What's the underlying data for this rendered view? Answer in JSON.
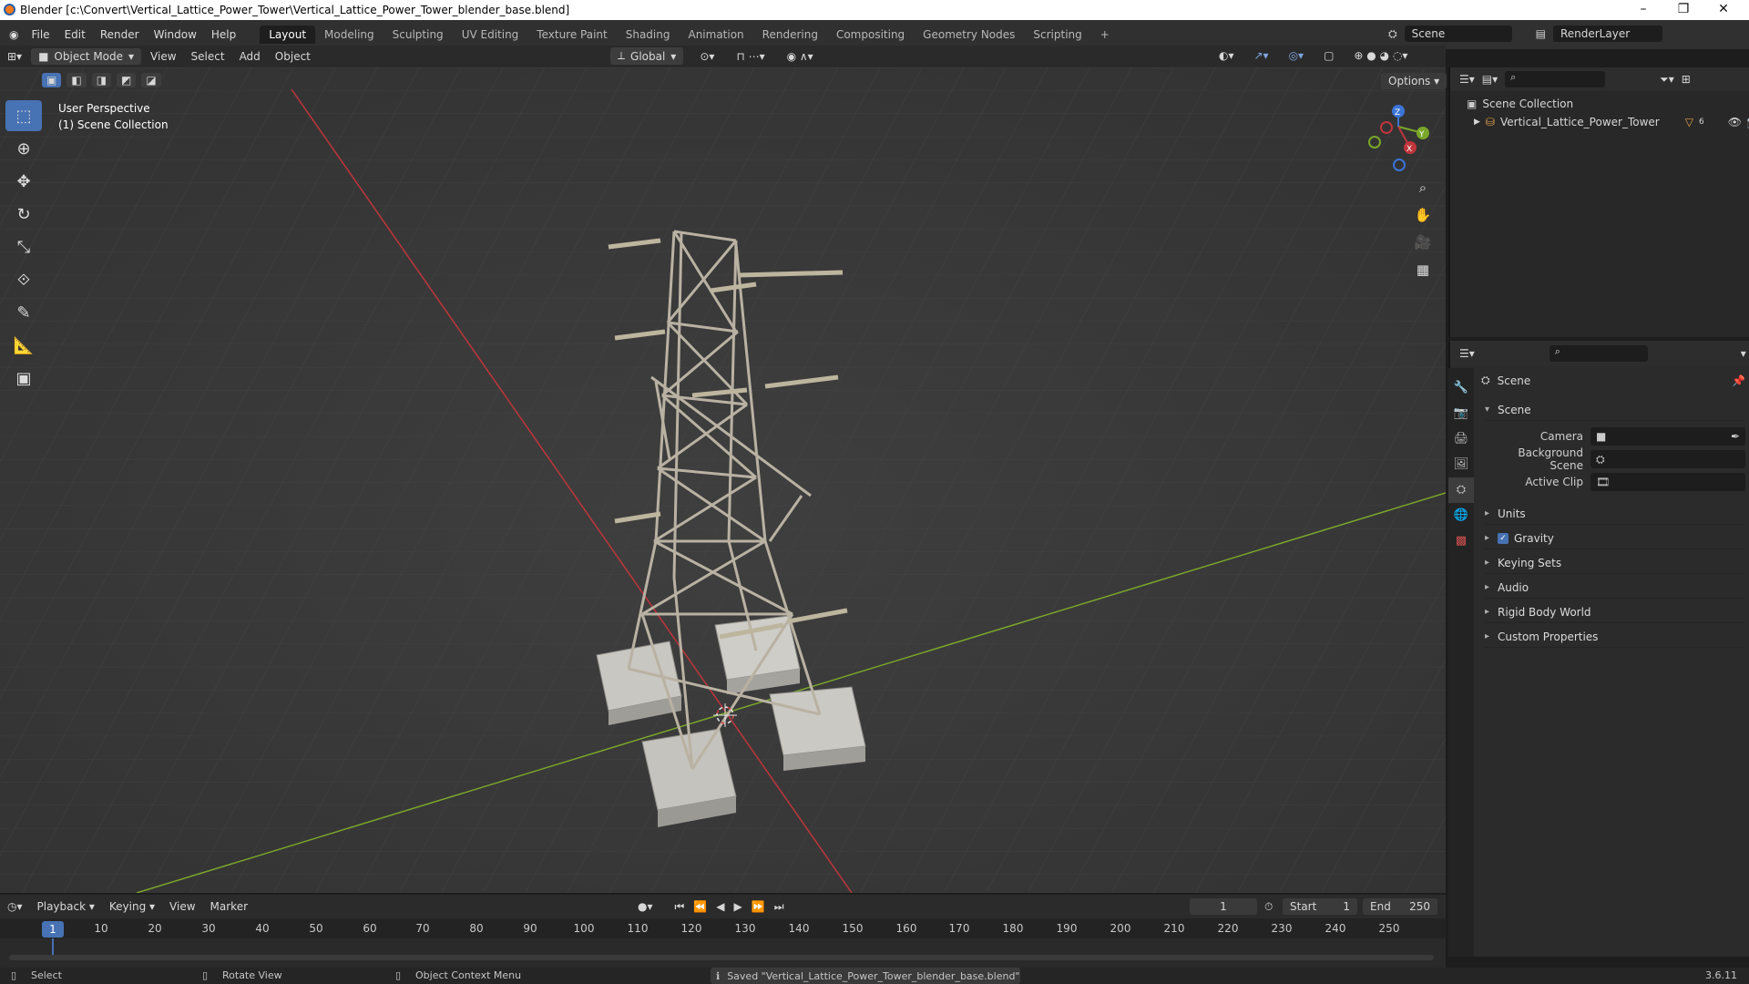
{
  "window": {
    "title": "Blender [c:\\Convert\\Vertical_Lattice_Power_Tower\\Vertical_Lattice_Power_Tower_blender_base.blend]",
    "minimize": "–",
    "maximize": "❐",
    "close": "✕"
  },
  "menus": [
    "File",
    "Edit",
    "Render",
    "Window",
    "Help"
  ],
  "workspaces": [
    "Layout",
    "Modeling",
    "Sculpting",
    "UV Editing",
    "Texture Paint",
    "Shading",
    "Animation",
    "Rendering",
    "Compositing",
    "Geometry Nodes",
    "Scripting"
  ],
  "workspace_add": "+",
  "scene_selector": "Scene",
  "view_layer_selector": "RenderLayer",
  "viewport_header": {
    "mode": "Object Mode",
    "menus": [
      "View",
      "Select",
      "Add",
      "Object"
    ],
    "transform_orientation": "Global",
    "options": "Options"
  },
  "viewport_overlay": {
    "perspective": "User Perspective",
    "collection": "(1) Scene Collection"
  },
  "gizmo_axes": {
    "z": "Z",
    "y": "Y",
    "x": "X"
  },
  "outliner": {
    "root": "Scene Collection",
    "items": [
      {
        "name": "Vertical_Lattice_Power_Tower",
        "badge": "6"
      }
    ]
  },
  "properties": {
    "context_title": "Scene",
    "panels": [
      {
        "label": "Scene",
        "expanded": true
      },
      {
        "label": "Units",
        "expanded": false
      },
      {
        "label": "Gravity",
        "expanded": false,
        "checkbox": true
      },
      {
        "label": "Keying Sets",
        "expanded": false
      },
      {
        "label": "Audio",
        "expanded": false
      },
      {
        "label": "Rigid Body World",
        "expanded": false
      },
      {
        "label": "Custom Properties",
        "expanded": false
      }
    ],
    "scene_fields": {
      "camera_label": "Camera",
      "background_label": "Background Scene",
      "clip_label": "Active Clip"
    }
  },
  "timeline": {
    "menus": [
      "Playback",
      "Keying",
      "View",
      "Marker"
    ],
    "current_frame": "1",
    "start_label": "Start",
    "start_value": "1",
    "end_label": "End",
    "end_value": "250",
    "ruler_ticks": [
      "1",
      "10",
      "20",
      "30",
      "40",
      "50",
      "60",
      "70",
      "80",
      "90",
      "100",
      "110",
      "120",
      "130",
      "140",
      "150",
      "160",
      "170",
      "180",
      "190",
      "200",
      "210",
      "220",
      "230",
      "240",
      "250"
    ]
  },
  "statusbar": {
    "select": "Select",
    "rotate": "Rotate View",
    "context_menu": "Object Context Menu",
    "message": "Saved \"Vertical_Lattice_Power_Tower_blender_base.blend\"",
    "version": "3.6.11"
  },
  "colors": {
    "accent": "#4772b3",
    "x_axis": "#c0353b",
    "y_axis": "#7aa62a",
    "z_axis": "#3a74d6",
    "tower": "#b9b2a3"
  }
}
